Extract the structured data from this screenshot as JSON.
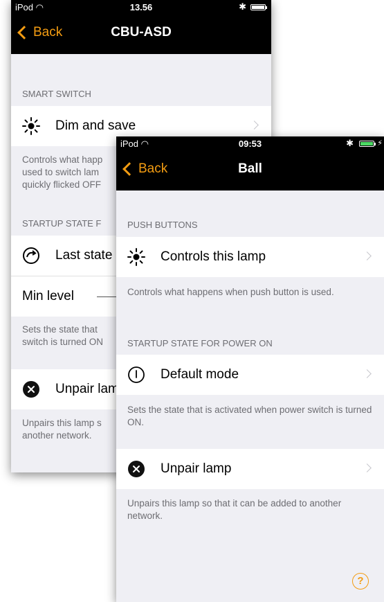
{
  "back_screen": {
    "status": {
      "carrier": "iPod",
      "time": "13.56"
    },
    "nav": {
      "back_label": "Back",
      "title": "CBU-ASD"
    },
    "section_smart": "SMART SWITCH",
    "dim_cell": {
      "label": "Dim and save"
    },
    "dim_footer": "Controls what happ\nused to switch lam\nquickly flicked OFF",
    "section_startup": "STARTUP STATE F",
    "last_state_cell": {
      "label": "Last state"
    },
    "min_level_cell": {
      "label": "Min level"
    },
    "startup_footer": "Sets the state that\nswitch is turned ON",
    "unpair_cell": {
      "label": "Unpair lam"
    },
    "unpair_footer": "Unpairs this lamp s\nanother network."
  },
  "front_screen": {
    "status": {
      "carrier": "iPod",
      "time": "09:53"
    },
    "nav": {
      "back_label": "Back",
      "title": "Ball"
    },
    "section_push": "PUSH BUTTONS",
    "controls_cell": {
      "label": "Controls this lamp"
    },
    "controls_footer": "Controls what happens when push button is used.",
    "section_startup": "STARTUP STATE FOR POWER ON",
    "default_cell": {
      "label": "Default mode"
    },
    "default_footer": "Sets the state that is activated when power switch is turned ON.",
    "unpair_cell": {
      "label": "Unpair lamp"
    },
    "unpair_footer": "Unpairs this lamp so that it can be added to another network.",
    "help": "?"
  },
  "colors": {
    "accent": "#f39c12",
    "nav_bg": "#000000",
    "group_bg": "#efeff4",
    "battery_green": "#4cd964"
  },
  "icons": [
    "wifi-icon",
    "bluetooth-icon",
    "battery-icon",
    "brightness-icon",
    "last-state-icon",
    "power-icon",
    "unpair-icon",
    "help-icon"
  ]
}
